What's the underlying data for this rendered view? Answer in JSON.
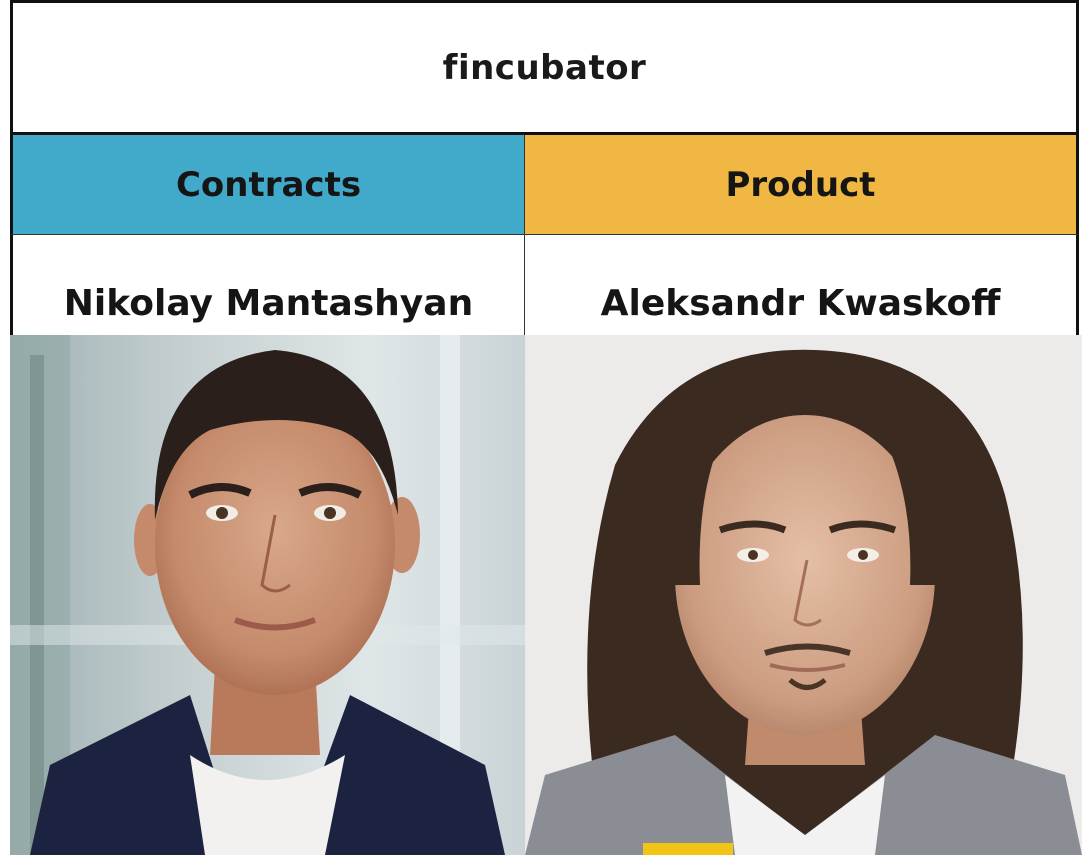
{
  "title": "fincubator",
  "columns": [
    {
      "heading": "Contracts",
      "name": "Nikolay Mantashyan",
      "heading_color": "#41aacb",
      "photo": "portrait-short-dark-hair-navy-blazer"
    },
    {
      "heading": "Product",
      "name": "Aleksandr Kwaskoff",
      "heading_color": "#f0b743",
      "photo": "portrait-long-dark-hair-grey-blazer"
    }
  ]
}
